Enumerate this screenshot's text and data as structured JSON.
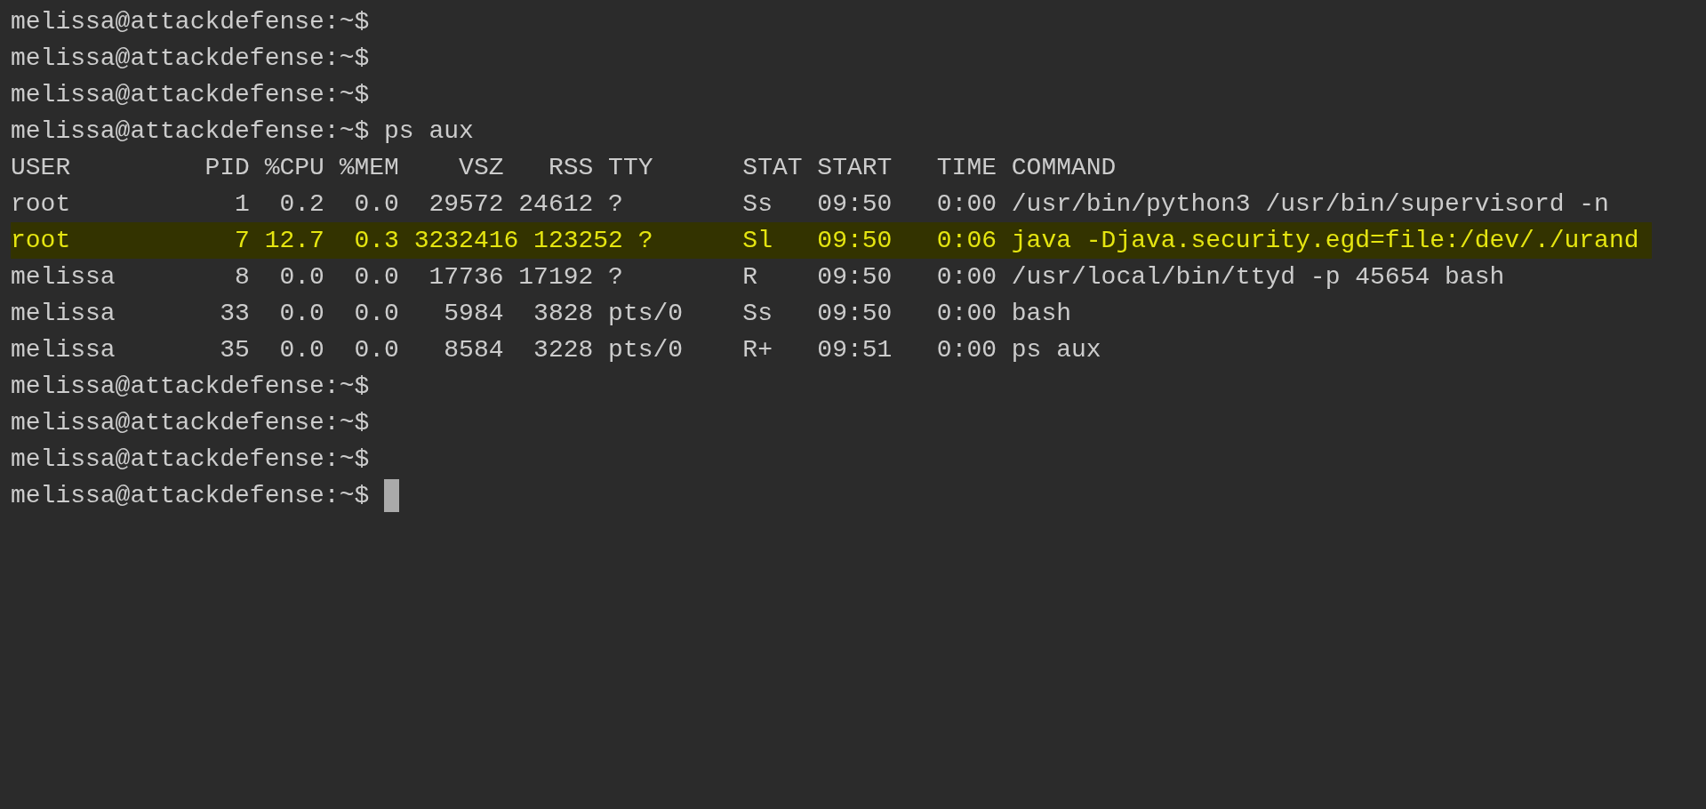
{
  "terminal": {
    "lines": [
      {
        "text": "melissa@attackdefense:~$",
        "highlighted": false,
        "cursor": false
      },
      {
        "text": "melissa@attackdefense:~$",
        "highlighted": false,
        "cursor": false
      },
      {
        "text": "melissa@attackdefense:~$",
        "highlighted": false,
        "cursor": false
      },
      {
        "text": "melissa@attackdefense:~$ ps aux",
        "highlighted": false,
        "cursor": false
      },
      {
        "text": "USER         PID %CPU %MEM    VSZ   RSS TTY      STAT START   TIME COMMAND",
        "highlighted": false,
        "cursor": false
      },
      {
        "text": "root           1  0.2  0.0  29572 24612 ?        Ss   09:50   0:00 /usr/bin/python3 /usr/bin/supervisord -n",
        "highlighted": false,
        "cursor": false
      },
      {
        "text": "root           7 12.7  0.3 3232416 123252 ?      Sl   09:50   0:06 java -Djava.security.egd=file:/dev/./urand",
        "highlighted": true,
        "cursor": false
      },
      {
        "text": "melissa        8  0.0  0.0  17736 17192 ?        R    09:50   0:00 /usr/local/bin/ttyd -p 45654 bash",
        "highlighted": false,
        "cursor": false
      },
      {
        "text": "melissa       33  0.0  0.0   5984  3828 pts/0    Ss   09:50   0:00 bash",
        "highlighted": false,
        "cursor": false
      },
      {
        "text": "melissa       35  0.0  0.0   8584  3228 pts/0    R+   09:51   0:00 ps aux",
        "highlighted": false,
        "cursor": false
      },
      {
        "text": "melissa@attackdefense:~$",
        "highlighted": false,
        "cursor": false
      },
      {
        "text": "melissa@attackdefense:~$",
        "highlighted": false,
        "cursor": false
      },
      {
        "text": "melissa@attackdefense:~$",
        "highlighted": false,
        "cursor": false
      },
      {
        "text": "melissa@attackdefense:~$",
        "highlighted": false,
        "cursor": true
      }
    ]
  }
}
